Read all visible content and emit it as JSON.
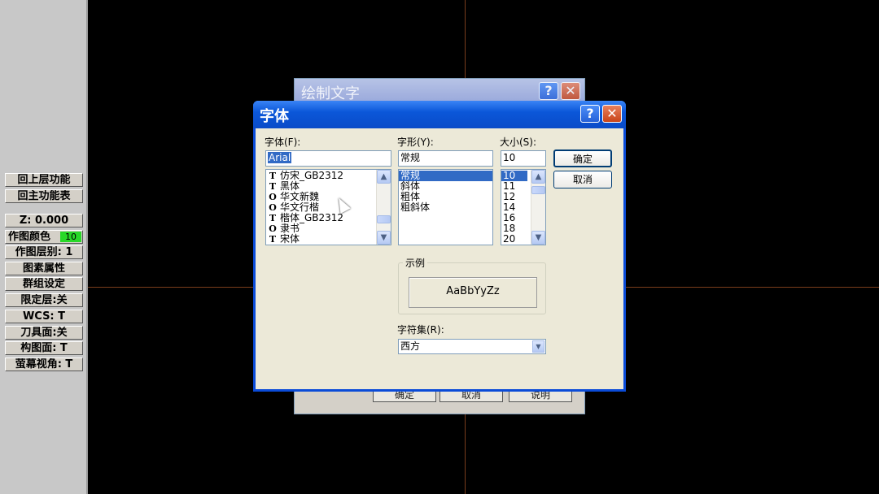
{
  "left_menu": {
    "btn_up_level": "回上层功能",
    "btn_main_menu": "回主功能表",
    "z_depth": "Z:  0.000",
    "draw_color_label": "作图颜色",
    "draw_color_value": "10",
    "draw_level": "作图层别:  1",
    "entity_attr": "图素属性",
    "group_setting": "群组设定",
    "mask_level": "限定层:关",
    "wcs": "WCS:  T",
    "tool_plane": "刀具面:关",
    "construction_plane": "构图面:  T",
    "screen_view": "萤幕视角:  T"
  },
  "back_dialog": {
    "title": "绘制文字",
    "btn_ok": "确定",
    "btn_cancel": "取消",
    "btn_help": "说明"
  },
  "font_dialog": {
    "title": "字体",
    "help_glyph": "?",
    "close_glyph": "✕",
    "font_label": "字体(F):",
    "font_value": "Arial",
    "font_list": [
      {
        "icon": "T",
        "name": "仿宋_GB2312"
      },
      {
        "icon": "T",
        "name": "黑体"
      },
      {
        "icon": "O",
        "name": "华文新魏"
      },
      {
        "icon": "O",
        "name": "华文行楷"
      },
      {
        "icon": "T",
        "name": "楷体_GB2312"
      },
      {
        "icon": "O",
        "name": "隶书"
      },
      {
        "icon": "T",
        "name": "宋体"
      }
    ],
    "style_label": "字形(Y):",
    "style_value": "常规",
    "style_list": [
      "常规",
      "斜体",
      "粗体",
      "粗斜体"
    ],
    "style_selected": "常规",
    "size_label": "大小(S):",
    "size_value": "10",
    "size_list": [
      "10",
      "11",
      "12",
      "14",
      "16",
      "18",
      "20"
    ],
    "size_selected": "10",
    "btn_ok": "确定",
    "btn_cancel": "取消",
    "sample_label": "示例",
    "sample_text": "AaBbYyZz",
    "charset_label": "字符集(R):",
    "charset_value": "西方"
  },
  "colors": {
    "desktop": "#000000",
    "title_bar": "#0a4bd8",
    "selection": "#316ac5",
    "color_chip": "#28d828"
  }
}
